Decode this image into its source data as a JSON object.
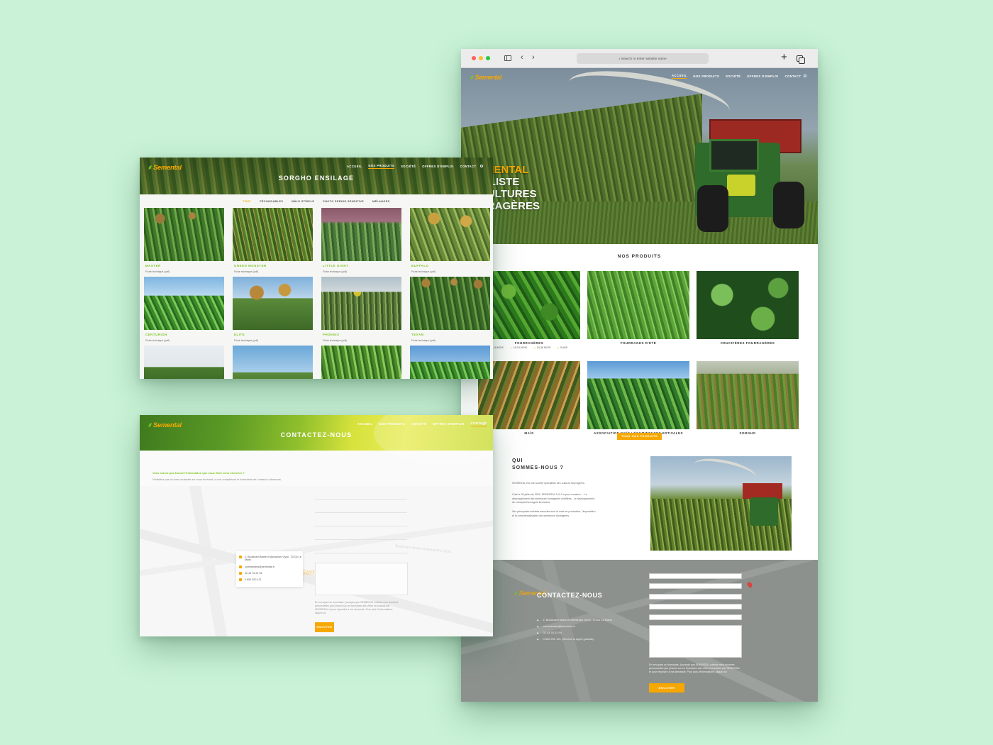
{
  "colors": {
    "background": "#c9f2d6",
    "accent": "#f6a800",
    "brand_green": "#7cc51d"
  },
  "brand": {
    "logo": "Semental"
  },
  "browser": {
    "url_placeholder": "Search or enter website name",
    "nav": [
      "ACCUEIL",
      "NOS PRODUITS",
      "SOCIÉTÉ",
      "OFFRES D'EMPLOI",
      "CONTACT"
    ],
    "hero_lines": [
      "SEMENTAL",
      "CIALISTE",
      "CULTURES",
      "RRAGÈRES"
    ],
    "products_title": "NOS PRODUITS",
    "products": [
      {
        "label": "FOURRAGÈRES",
        "meta": [
          "18 MOIS",
          "18-24 MOIS",
          "24-36 MOIS",
          "5 ANS"
        ]
      },
      {
        "label": "FOURRAGES D'ÉTÉ"
      },
      {
        "label": "CRUCIFÈRES FOURRAGÈRES"
      },
      {
        "label": "MAÏS"
      },
      {
        "label": "ASSOCIATION MAÏS LÉGUMINEUSES ESTIVALES"
      },
      {
        "label": "SORGHO"
      }
    ],
    "all_products_button": "TOUS NOS PRODUITS",
    "about_title_1": "QUI",
    "about_title_2": "SOMMES-NOUS ?",
    "about_p1": "SEMENTAL est une société spécialiste des cultures fourragères.",
    "about_p2": "Créé le 30 juillet de 2002, SEMENTAL S.A.S a pour vocation : - Le développement des semences fourragères certifiées - Le développement de concepts fourragers innovants",
    "about_p3": "Ses principales activités associés sont la mise en production, l'importation et la commercialisation des semences fourragères.",
    "contact_title": "CONTACTEZ-NOUS",
    "contact_info": [
      "2, Boulevard Marie et Alexandre Oyon, 72100 Le Mans",
      "commandes@semental.fr",
      "02 43 76 22 94",
      "0 800 200 121 (Service & appel gratuits)"
    ],
    "contact_legal": "En envoyant ce formulaire, j'accepte que SEMENTAL collecte mes données personnelles que j'inscris sur ce formulaire afin d'être recontacté par SEMENTAL et pour répondre à ma demande. Pour plus d'informations, cliquez ici",
    "send_button": "ENVOYER"
  },
  "sorgho": {
    "nav": [
      "ACCUEIL",
      "NOS PRODUITS",
      "SOCIÉTÉ",
      "OFFRES D'EMPLOI",
      "CONTACT"
    ],
    "title": "SORGHO ENSILAGE",
    "filters": [
      "TOUT",
      "FÉCONDABLES",
      "MÂLE STÉRILE",
      "PHOTO PERIOD SENSITIVE",
      "MÉLANGES"
    ],
    "items": [
      {
        "name": "MASTER",
        "pdf": "Fiche technique (pdf)"
      },
      {
        "name": "GREEN MONSTER",
        "pdf": "Fiche technique (pdf)"
      },
      {
        "name": "LITTLE GIANT",
        "pdf": "Fiche technique (pdf)"
      },
      {
        "name": "BUFFALO",
        "pdf": "Fiche technique (pdf)"
      },
      {
        "name": "CENTURION",
        "pdf": "Fiche technique (pdf)"
      },
      {
        "name": "ELITE",
        "pdf": "Fiche technique (pdf)"
      },
      {
        "name": "PHOENIX",
        "pdf": "Fiche technique (pdf)"
      },
      {
        "name": "TEXAN",
        "pdf": "Fiche technique (pdf)"
      }
    ]
  },
  "contact_page": {
    "nav": [
      "ACCUEIL",
      "NOS PRODUITS",
      "SOCIÉTÉ",
      "OFFRES D'EMPLOI",
      "CONTACT"
    ],
    "title": "CONTACTEZ-NOUS",
    "question": "Vous n'avez pas trouvé l'information que vous êtiez venu chercher ?",
    "subtitle": "N'hésitez pas à nous contacter en nous écrivant, ou en complétant le formulaire de contact ci-dessous.",
    "info": [
      "2, Boulevard Marie et Alexandre Oyon, 72100 Le Mans",
      "commandes@semental.fr",
      "02 43 76 22 94",
      "0 800 200 121"
    ],
    "map_street": "Boulevard Marie et Alexandre Oyon",
    "legal": "En envoyant ce formulaire, j'accepte que SEMENTAL collecte mes données personnelles que j'inscris sur ce formulaire afin d'être recontacté par SEMENTAL et pour répondre à ma demande. Pour plus d'informations, cliquez ici",
    "send_button": "ENVOYER"
  }
}
